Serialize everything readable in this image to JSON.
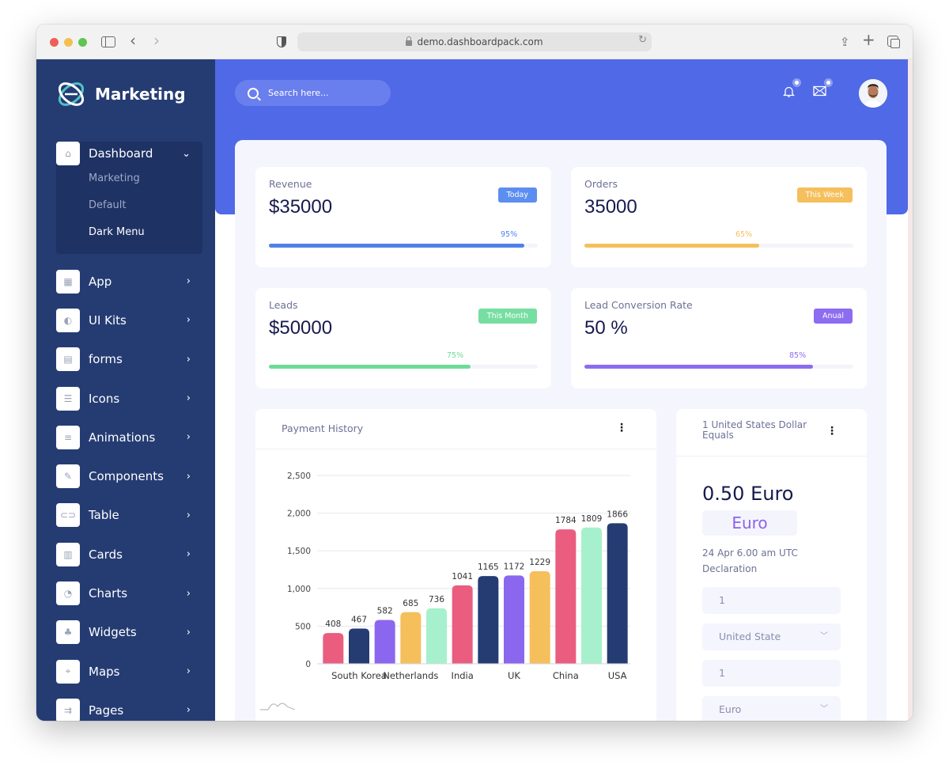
{
  "browser": {
    "url": "demo.dashboardpack.com"
  },
  "sidebar": {
    "brand": "Marketing",
    "dashboard": {
      "label": "Dashboard",
      "icon": "home-icon",
      "subitems": [
        {
          "label": "Marketing",
          "active": false
        },
        {
          "label": "Default",
          "active": false
        },
        {
          "label": "Dark Menu",
          "active": true
        }
      ]
    },
    "items": [
      {
        "label": "App",
        "icon": "apps-grid-icon"
      },
      {
        "label": "UI Kits",
        "icon": "ui-kits-icon"
      },
      {
        "label": "forms",
        "icon": "form-icon"
      },
      {
        "label": "Icons",
        "icon": "icons-icon"
      },
      {
        "label": "Animations",
        "icon": "animation-icon"
      },
      {
        "label": "Components",
        "icon": "components-icon"
      },
      {
        "label": "Table",
        "icon": "table-icon"
      },
      {
        "label": "Cards",
        "icon": "cards-icon"
      },
      {
        "label": "Charts",
        "icon": "chart-icon"
      },
      {
        "label": "Widgets",
        "icon": "widgets-icon"
      },
      {
        "label": "Maps",
        "icon": "map-pin-icon"
      },
      {
        "label": "Pages",
        "icon": "pages-icon"
      }
    ]
  },
  "header": {
    "search_placeholder": "Search here...",
    "notifications_icon": "bell-icon",
    "messages_icon": "mail-icon"
  },
  "stats": [
    {
      "title": "Revenue",
      "value": "$35000",
      "badge": "Today",
      "badge_color": "#5b8ef0",
      "progress_label": "95%",
      "progress": 0.95,
      "color": "#5181e8"
    },
    {
      "title": "Orders",
      "value": "35000",
      "badge": "This Week",
      "badge_color": "#f5bf5c",
      "progress_label": "65%",
      "progress": 0.65,
      "color": "#f5bf5c"
    },
    {
      "title": "Leads",
      "value": "$50000",
      "badge": "This Month",
      "badge_color": "#77dea1",
      "progress_label": "75%",
      "progress": 0.75,
      "color": "#6ddc98"
    },
    {
      "title": "Lead Conversion Rate",
      "value": "50 %",
      "badge": "Anual",
      "badge_color": "#8c6cf0",
      "progress_label": "85%",
      "progress": 0.85,
      "color": "#8c6cf0"
    }
  ],
  "payment_history": {
    "title": "Payment History"
  },
  "chart_data": {
    "type": "bar",
    "title": "Payment History",
    "xlabel": "",
    "ylabel": "",
    "ylim": [
      0,
      2500
    ],
    "yticks": [
      0,
      500,
      1000,
      1500,
      2000,
      2500
    ],
    "ytick_labels": [
      "0",
      "500",
      "1,000",
      "1,500",
      "2,000",
      "2,500"
    ],
    "grid": true,
    "values": [
      408,
      467,
      582,
      685,
      736,
      1041,
      1165,
      1172,
      1229,
      1784,
      1809,
      1866
    ],
    "colors": [
      "#ea5d7f",
      "#253c73",
      "#8b67f0",
      "#f5bf5c",
      "#a7f0cd",
      "#ea5d7f",
      "#253c73",
      "#8b67f0",
      "#f5bf5c",
      "#ea5d7f",
      "#a7f0cd",
      "#253c73"
    ],
    "category_labels": [
      {
        "label": "South Korea",
        "at_bar": 1
      },
      {
        "label": "Netherlands",
        "at_bar": 3
      },
      {
        "label": "India",
        "at_bar": 5
      },
      {
        "label": "UK",
        "at_bar": 7
      },
      {
        "label": "China",
        "at_bar": 9
      },
      {
        "label": "USA",
        "at_bar": 11
      }
    ]
  },
  "converter": {
    "title": "1 United States Dollar Equals",
    "value": "0.50 Euro",
    "currency_chip": "Euro",
    "date": "24 Apr 6.00 am UTC",
    "note": "Declaration",
    "amount_from": "1",
    "currency_from": "United State",
    "amount_to": "1",
    "currency_to": "Euro"
  }
}
